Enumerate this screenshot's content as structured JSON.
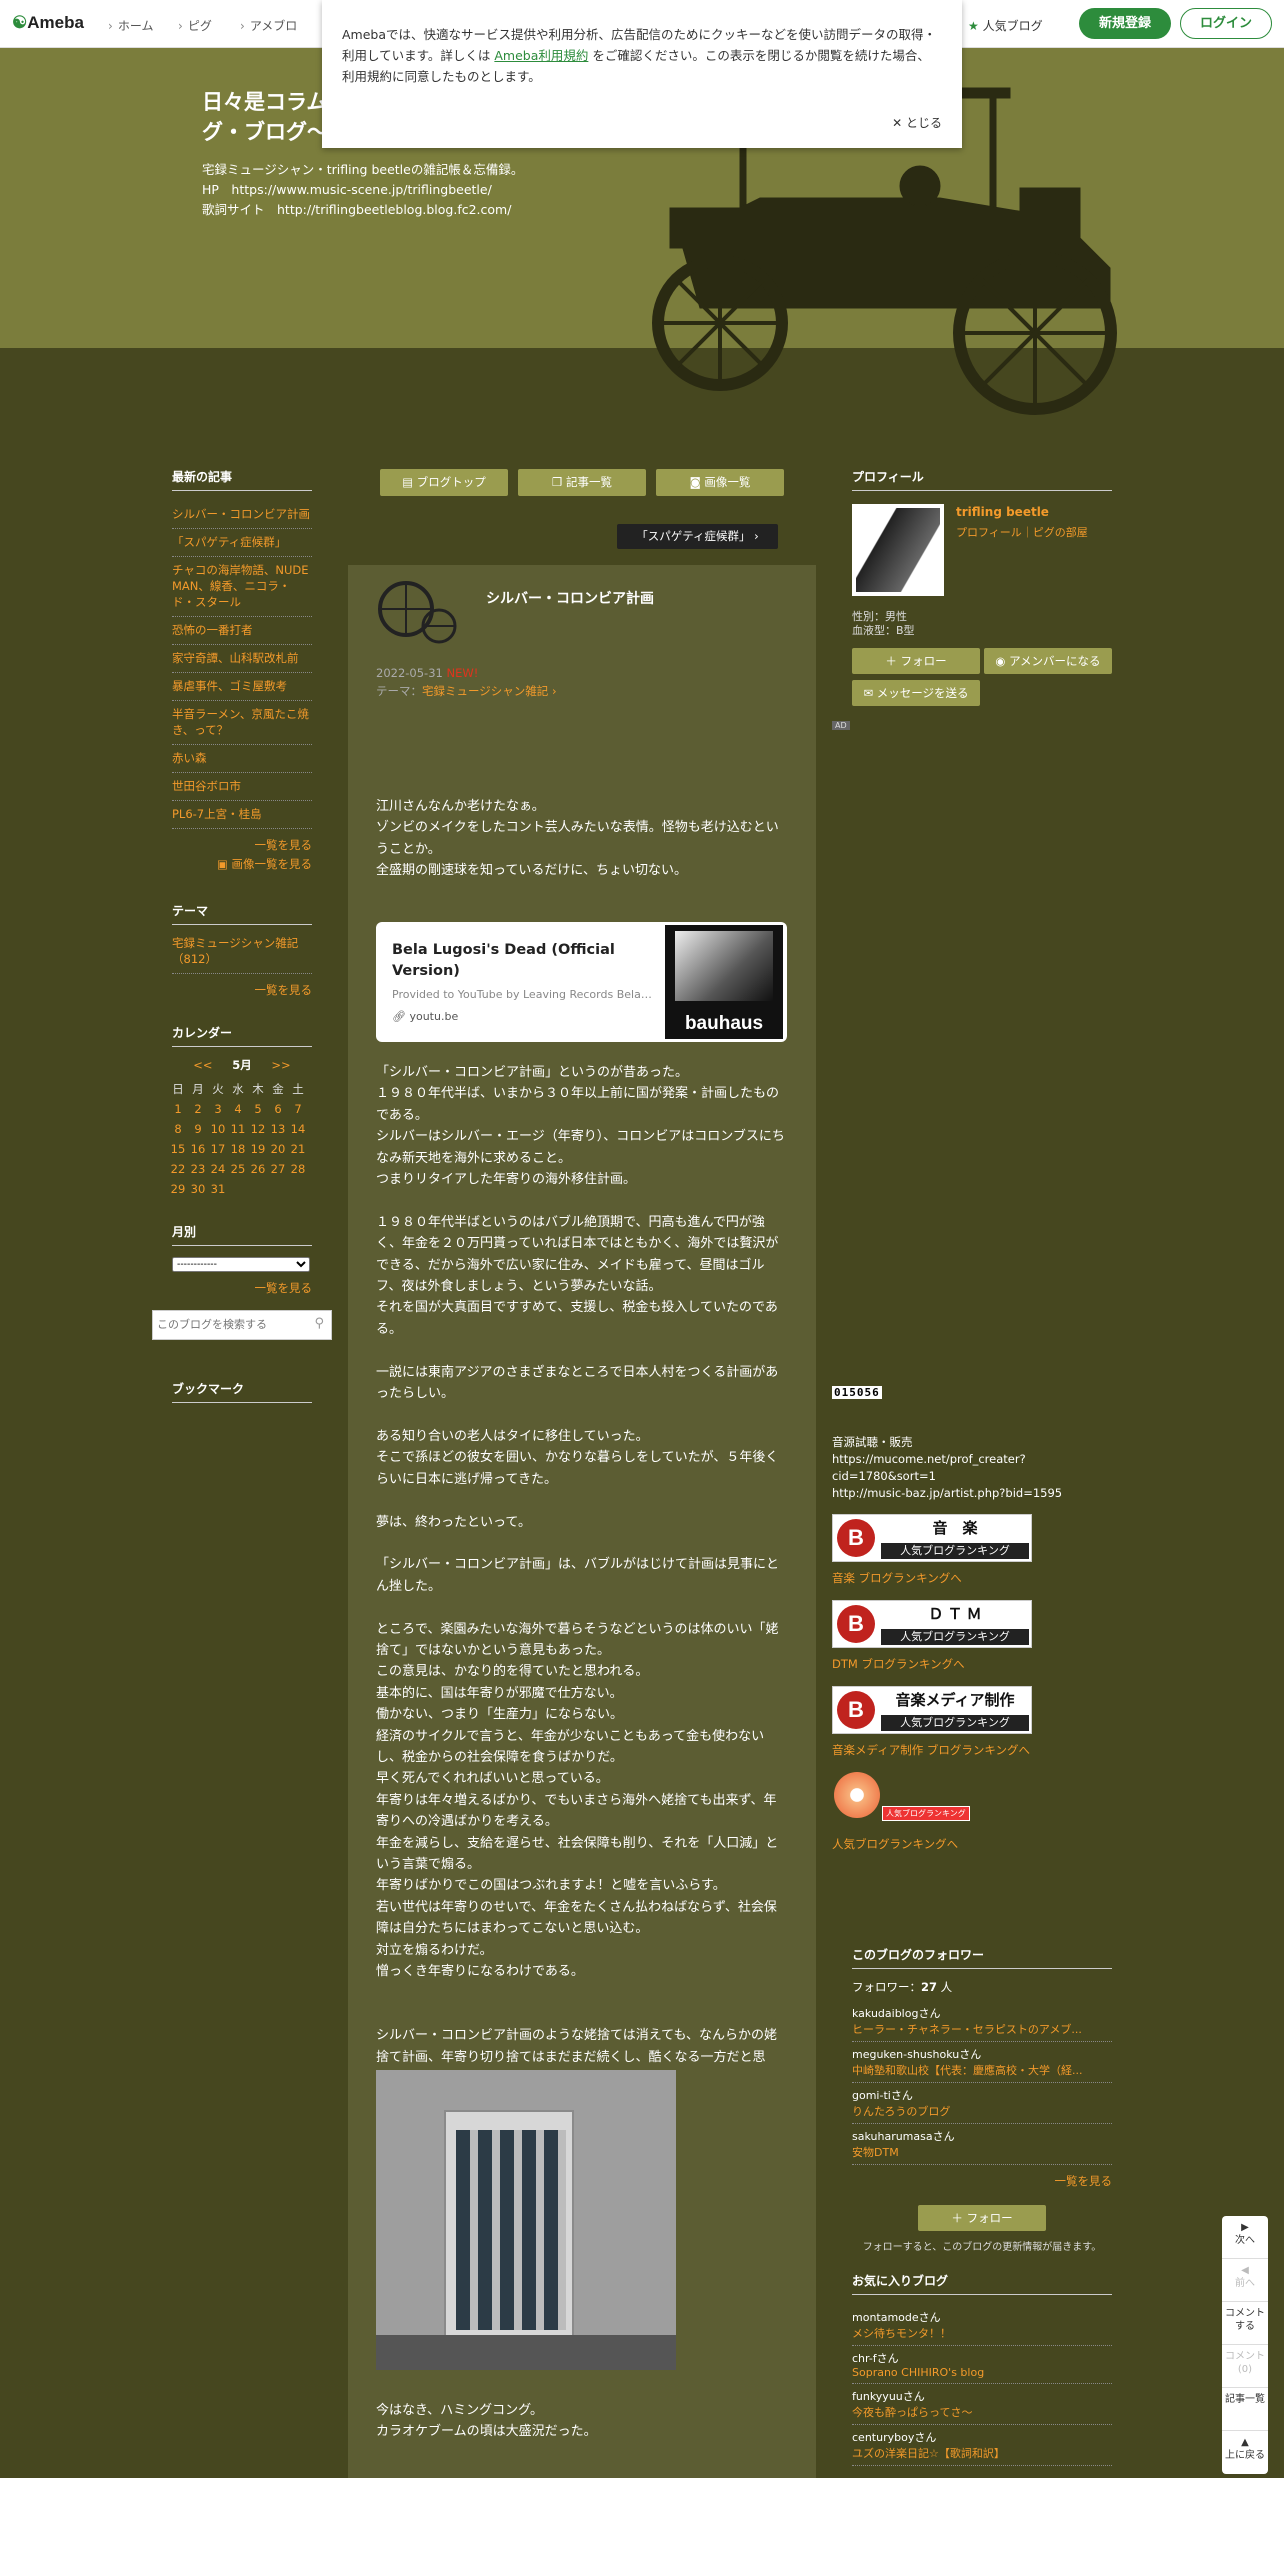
{
  "topbar": {
    "logo": "Ameba",
    "nav": [
      "ホーム",
      "ピグ",
      "アメブロ"
    ],
    "ranking": "人気ブログ",
    "signup": "新規登録",
    "login": "ログイン"
  },
  "cookie": {
    "text_before": "Amebaでは、快適なサービス提供や利用分析、広告配信のためにクッキーなどを使い訪問データの取得・利用しています。詳しくは ",
    "link": "Ameba利用規約",
    "text_after": " をご確認ください。この表示を閉じるか閲覧を続けた場合、利用規約に同意したものとします。",
    "close": "とじる"
  },
  "header": {
    "title": "日々是コラム　～トライフリング・ブログ～",
    "description": "宅録ミュージシャン・trifling beetleの雑記帳＆忘備録。\nHP　https://www.music-scene.jp/triflingbeetle/\n歌詞サイト　http://triflingbeetleblog.blog.fc2.com/"
  },
  "left": {
    "recent_heading": "最新の記事",
    "recent": [
      "シルバー・コロンビア計画",
      "「スパゲティ症候群」",
      "チャコの海岸物語、NUDE MAN、線香、ニコラ・ド・スタール",
      "恐怖の一番打者",
      "家守奇譚、山科駅改札前",
      "暴虐事件、ゴミ屋敷考",
      "半音ラーメン、京風たこ焼き、って？",
      "赤い森",
      "世田谷ボロ市",
      "PL6-7上宮・桂島"
    ],
    "more": "一覧を見る",
    "image_more": "画像一覧を見る",
    "theme_heading": "テーマ",
    "theme_item": "宅録ミュージシャン雑記（812）",
    "theme_more": "一覧を見る",
    "calendar_heading": "カレンダー",
    "cal_prev": "<<",
    "cal_month": "5月",
    "cal_next": ">>",
    "weekdays": [
      "日",
      "月",
      "火",
      "水",
      "木",
      "金",
      "土"
    ],
    "days": [
      [
        "1",
        "2",
        "3",
        "4",
        "5",
        "6",
        "7"
      ],
      [
        "8",
        "9",
        "10",
        "11",
        "12",
        "13",
        "14"
      ],
      [
        "15",
        "16",
        "17",
        "18",
        "19",
        "20",
        "21"
      ],
      [
        "22",
        "23",
        "24",
        "25",
        "26",
        "27",
        "28"
      ],
      [
        "29",
        "30",
        "31",
        "",
        "",
        "",
        ""
      ]
    ],
    "monthly_heading": "月別",
    "monthly_select": "------------",
    "monthly_more": "一覧を見る",
    "search_placeholder": "このブログを検索する",
    "bookmark_heading": "ブックマーク"
  },
  "main": {
    "btn_top": "ブログトップ",
    "btn_entries": "記事一覧",
    "btn_images": "画像一覧",
    "prev_entry": "「スパゲティ症候群」",
    "entry_title": "シルバー・コロンビア計画",
    "date": "2022-05-31",
    "date_tag": "NEW!",
    "theme_label": "テーマ：",
    "theme": "宅録ミュージシャン雑記",
    "p1": "江川さんなんか老けたなぁ。\nゾンビのメイクをしたコント芸人みたいな表情。怪物も老け込むということか。\n全盛期の剛速球を知っているだけに、ちょい切ない。",
    "yt_title": "Bela Lugosi's Dead (Official Version)",
    "yt_provider": "Provided to YouTube by Leaving Records Bela Lugosi's Dead",
    "yt_domain": "youtu.be",
    "yt_thumb_text": "bauhaus",
    "p2": "「シルバー・コロンビア計画」というのが昔あった。\n１９８０年代半ば、いまから３０年以上前に国が発案・計画したものである。\nシルバーはシルバー・エージ（年寄り）、コロンビアはコロンブスにちなみ新天地を海外に求めること。\nつまりリタイアした年寄りの海外移住計画。\n\n１９８０年代半ばというのはバブル絶頂期で、円高も進んで円が強く、年金を２０万円貰っていれば日本ではともかく、海外では贅沢ができる、だから海外で広い家に住み、メイドも雇って、昼間はゴルフ、夜は外食しましょう、という夢みたいな話。\nそれを国が大真面目ですすめて、支援し、税金も投入していたのである。\n\n一説には東南アジアのさまざまなところで日本人村をつくる計画があったらしい。\n\nある知り合いの老人はタイに移住していった。\nそこで孫ほどの彼女を囲い、かなりな暮らしをしていたが、５年後くらいに日本に逃げ帰ってきた。\n\n夢は、終わったといって。\n\n「シルバー・コロンビア計画」は、バブルがはじけて計画は見事にとん挫した。\n\nところで、楽園みたいな海外で暮らそうなどというのは体のいい「姥捨て」ではないかという意見もあった。\nこの意見は、かなり的を得ていたと思われる。\n基本的に、国は年寄りが邪魔で仕方ない。\n働かない、つまり「生産力」にならない。\n経済のサイクルで言うと、年金が少ないこともあって金も使わないし、税金からの社会保障を食うばかりだ。\n早く死んでくれればいいと思っている。\n年寄りは年々増えるばかり、でもいまさら海外へ姥捨ても出来ず、年寄りへの冷遇ばかりを考える。\n年金を減らし、支給を遅らせ、社会保障も削り、それを「人口減」という言葉で煽る。\n年寄りばかりでこの国はつぶれますよ！と嘘を言いふらす。\n若い世代は年寄りのせいで、年金をたくさん払わねばならず、社会保障は自分たちにはまわってこないと思い込む。\n対立を煽るわけだ。\n憎っくき年寄りになるわけである。\n\n\nシルバー・コロンビア計画のような姥捨ては消えても、なんらかの姥捨て計画、年寄り切り捨てはまだまだ続くし、酷くなる一方だと思う。",
    "p3": "今はなき、ハミングコング。\nカラオケブームの頃は大盛況だった。"
  },
  "right": {
    "profile_heading": "プロフィール",
    "profile_name": "trifling beetle",
    "profile_links": "プロフィール｜ピグの部屋",
    "gender": "性別：男性",
    "blood": "血液型：B型",
    "follow": "フォロー",
    "member": "アメンバーになる",
    "message": "メッセージを送る",
    "ad": "AD",
    "counter": "015056",
    "sale_text": "音源試聴・販売\nhttps://mucome.net/prof_creater?cid=1780&sort=1\nhttp://music-baz.jp/artist.php?bid=1595",
    "ranks": [
      {
        "title": "音　楽",
        "sub": "人気ブログランキング",
        "link": "音楽 ブログランキングへ"
      },
      {
        "title": "Ｄ Ｔ Ｍ",
        "sub": "人気ブログランキング",
        "link": "DTM ブログランキングへ"
      },
      {
        "title": "音楽メディア制作",
        "sub": "人気ブログランキング",
        "link": "音楽メディア制作 ブログランキングへ"
      }
    ],
    "popular_badge": "人気ブログランキング",
    "popular_link": "人気ブログランキングへ",
    "followers_heading": "このブログのフォロワー",
    "followers_label": "フォロワー：",
    "followers_count": "27",
    "followers_unit": "人",
    "followers": [
      {
        "user": "kakudaiblogさん",
        "blog": "ヒーラー・チャネラー・セラピストのアメブ..."
      },
      {
        "user": "meguken-shushokuさん",
        "blog": "中崎塾和歌山校【代表：慶應高校・大学（経..."
      },
      {
        "user": "gomi-tiさん",
        "blog": "りんたろうのブログ"
      },
      {
        "user": "sakuharumasaさん",
        "blog": "安物DTM"
      }
    ],
    "followers_more": "一覧を見る",
    "follow_btn": "フォロー",
    "follow_note": "フォローすると、このブログの更新情報が届きます。",
    "fav_heading": "お気に入りブログ",
    "favs": [
      {
        "user": "montamodeさん",
        "blog": "メシ待ちモンタ！！"
      },
      {
        "user": "chr-fさん",
        "blog": "Soprano CHIHIRO's blog"
      },
      {
        "user": "funkyyuuさん",
        "blog": "今夜も酔っぱらってさ～"
      },
      {
        "user": "centuryboyさん",
        "blog": "ユズの洋楽日記☆【歌詞和訳】"
      }
    ]
  },
  "floatnav": {
    "next": "次へ",
    "prev": "前へ",
    "comment": "コメントする",
    "comments": "コメント(0)",
    "list": "記事一覧",
    "top": "上に戻る"
  },
  "colors": {
    "brand": "#2d8c3c",
    "link": "#f39a2b",
    "main_bg": "#5c5d33",
    "page_bg": "#46471f",
    "header_bg": "#7b7d3c"
  }
}
